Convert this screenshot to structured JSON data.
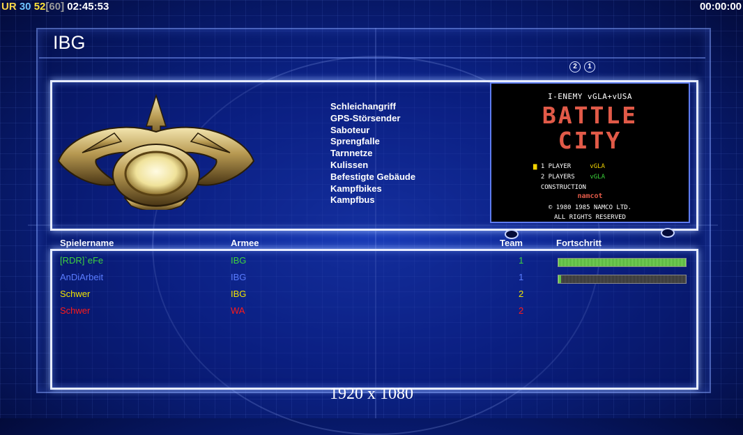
{
  "hud": {
    "ur_label": "UR",
    "fps_min": "30",
    "fps_current": "52",
    "fps_cap": "[60]",
    "clock": "02:45:53",
    "timer": "00:00:00"
  },
  "page_title": "IBG",
  "indicators": [
    "2",
    "1"
  ],
  "upgrades": [
    "Schleichangriff",
    "GPS-Störsender",
    "Saboteur",
    "Sprengfalle",
    "Tarnnetze",
    "Kulissen",
    "Befestigte Gebäude",
    "Kampfbikes",
    "Kampfbus"
  ],
  "map_preview": {
    "top_line": "I-ENEMY vGLA+vUSA",
    "logo_line1": "BATTLE",
    "logo_line2": "CITY",
    "menu": [
      {
        "marker": "▆",
        "label": "1 PLAYER",
        "tag": "vGLA"
      },
      {
        "marker": "",
        "label": "2 PLAYERS",
        "tag": "vGLA"
      },
      {
        "marker": "",
        "label": "CONSTRUCTION",
        "tag": ""
      }
    ],
    "publisher": "namcot",
    "copyright_line1": "© 1980 1985 NAMCO LTD.",
    "copyright_line2": "ALL RIGHTS RESERVED"
  },
  "table": {
    "headers": {
      "name": "Spielername",
      "army": "Armee",
      "team": "Team",
      "progress": "Fortschritt"
    },
    "rows": [
      {
        "name": "[RDR]`eFe",
        "army": "IBG",
        "team": "1",
        "color": "#3fd23f",
        "progress": 1.0
      },
      {
        "name": "AnDiArbeit",
        "army": "IBG",
        "team": "1",
        "color": "#5a7cff",
        "progress": 0.02
      },
      {
        "name": "Schwer",
        "army": "IBG",
        "team": "2",
        "color": "#f2e500",
        "progress": null
      },
      {
        "name": "Schwer",
        "army": "WA",
        "team": "2",
        "color": "#ff1a1a",
        "progress": null
      }
    ]
  },
  "resolution_label": "1920 x 1080"
}
